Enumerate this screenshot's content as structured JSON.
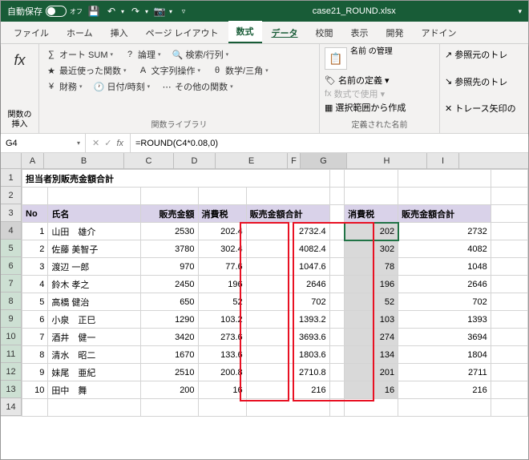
{
  "titlebar": {
    "autosave_label": "自動保存",
    "autosave_state": "オフ",
    "filename": "case21_ROUND.xlsx"
  },
  "tabs": [
    "ファイル",
    "ホーム",
    "挿入",
    "ページ レイアウト",
    "数式",
    "データ",
    "校閲",
    "表示",
    "開発",
    "アドイン"
  ],
  "active_tab": "数式",
  "active_tab2": "データ",
  "ribbon": {
    "insert_fn": "関数の\n挿入",
    "lib": {
      "autosum": "オート SUM",
      "recent": "最近使った関数",
      "financial": "財務",
      "logical": "論理",
      "text": "文字列操作",
      "datetime": "日付/時刻",
      "lookup": "検索/行列",
      "math": "数学/三角",
      "more": "その他の関数",
      "group_label": "関数ライブラリ"
    },
    "names": {
      "manager": "名前\nの管理",
      "define": "名前の定義",
      "use": "数式で使用",
      "create": "選択範囲から作成",
      "group_label": "定義された名前"
    },
    "trace": {
      "precedents": "参照元のトレ",
      "dependents": "参照先のトレ",
      "remove": "トレース矢印の"
    }
  },
  "formula_bar": {
    "cell_ref": "G4",
    "formula": "=ROUND(C4*0.08,0)"
  },
  "columns": [
    "A",
    "B",
    "C",
    "D",
    "E",
    "F",
    "G",
    "H",
    "I"
  ],
  "sheet": {
    "title": "担当者別販売金額合計",
    "headers": {
      "no": "No",
      "name": "氏名",
      "sales": "販売金額",
      "tax": "消費税",
      "total": "販売金額合計",
      "tax2": "消費税",
      "total2": "販売金額合計"
    },
    "rows": [
      {
        "no": 1,
        "name": "山田　雄介",
        "sales": 2530,
        "tax": 202.4,
        "total": 2732.4,
        "tax2": 202,
        "total2": 2732
      },
      {
        "no": 2,
        "name": "佐藤 美智子",
        "sales": 3780,
        "tax": 302.4,
        "total": 4082.4,
        "tax2": 302,
        "total2": 4082
      },
      {
        "no": 3,
        "name": "渡辺 一郎",
        "sales": 970,
        "tax": 77.6,
        "total": 1047.6,
        "tax2": 78,
        "total2": 1048
      },
      {
        "no": 4,
        "name": "鈴木 孝之",
        "sales": 2450,
        "tax": 196,
        "total": 2646,
        "tax2": 196,
        "total2": 2646
      },
      {
        "no": 5,
        "name": "高橋 健治",
        "sales": 650,
        "tax": 52,
        "total": 702,
        "tax2": 52,
        "total2": 702
      },
      {
        "no": 6,
        "name": "小泉　正巳",
        "sales": 1290,
        "tax": 103.2,
        "total": 1393.2,
        "tax2": 103,
        "total2": 1393
      },
      {
        "no": 7,
        "name": "酒井　健一",
        "sales": 3420,
        "tax": 273.6,
        "total": 3693.6,
        "tax2": 274,
        "total2": 3694
      },
      {
        "no": 8,
        "name": "清水　昭二",
        "sales": 1670,
        "tax": 133.6,
        "total": 1803.6,
        "tax2": 134,
        "total2": 1804
      },
      {
        "no": 9,
        "name": "妹尾　亜紀",
        "sales": 2510,
        "tax": 200.8,
        "total": 2710.8,
        "tax2": 201,
        "total2": 2711
      },
      {
        "no": 10,
        "name": "田中　舞",
        "sales": 200,
        "tax": 16,
        "total": 216,
        "tax2": 16,
        "total2": 216
      }
    ]
  }
}
